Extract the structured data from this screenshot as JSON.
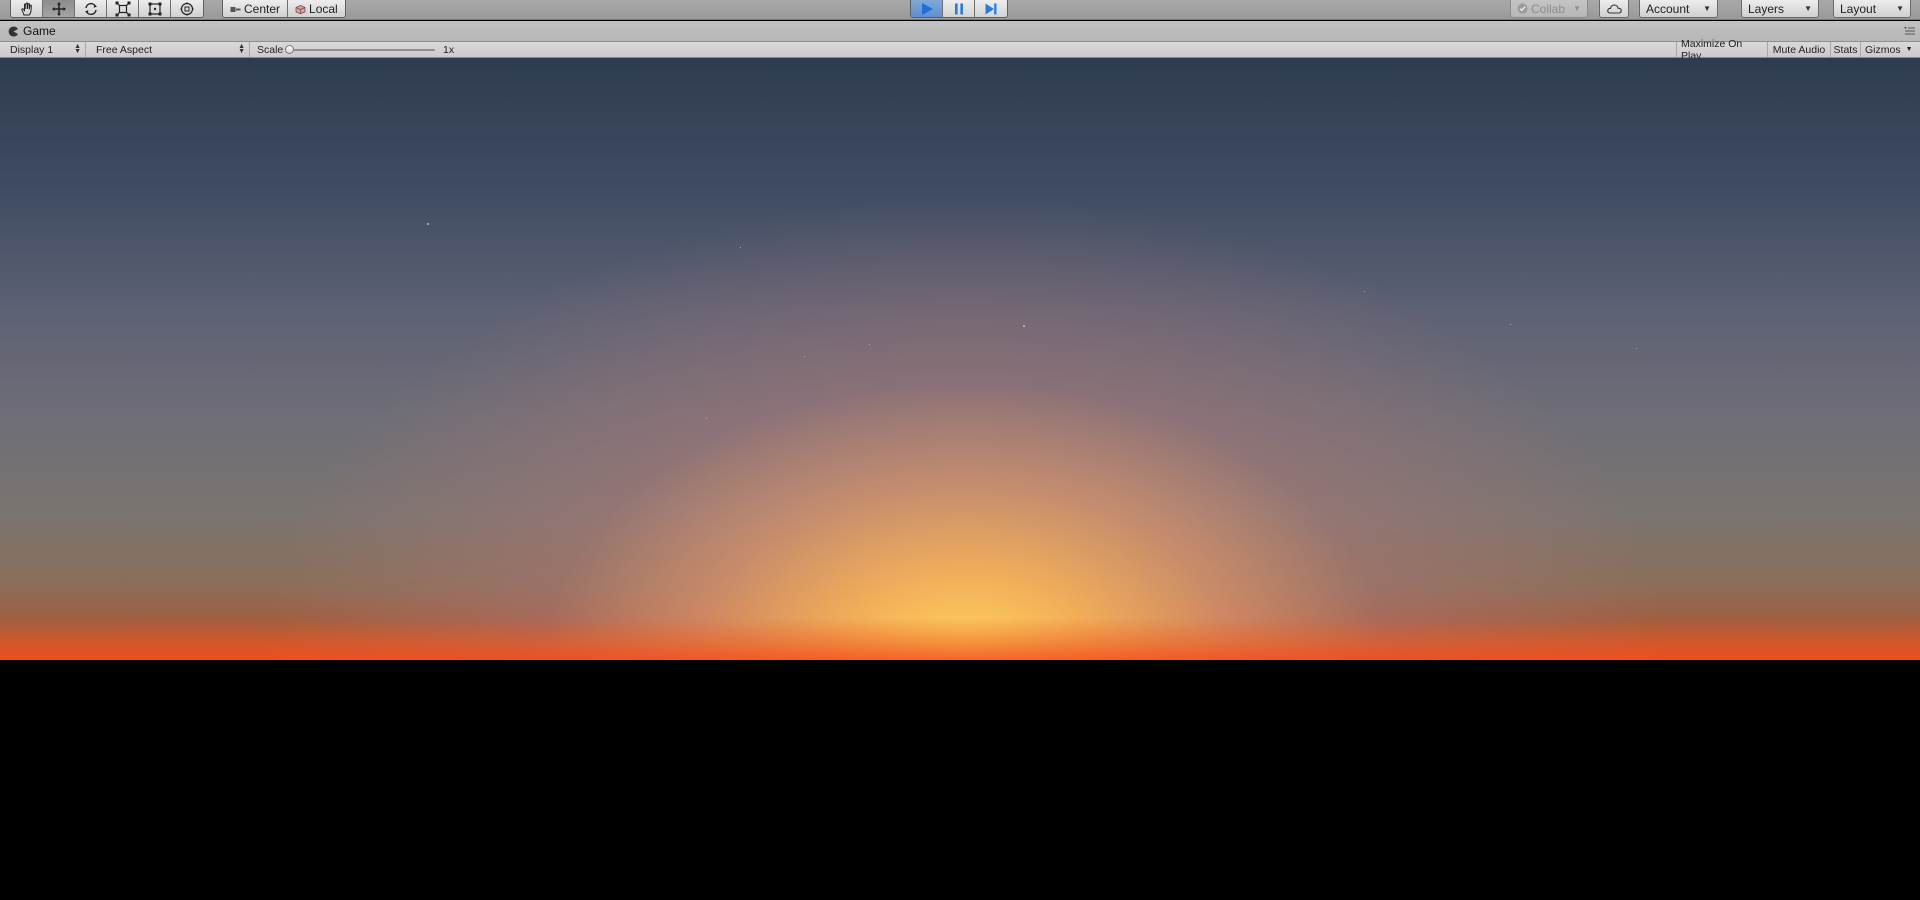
{
  "toolbar": {
    "transform_tools": [
      "hand-tool",
      "move-tool",
      "rotate-tool",
      "scale-tool",
      "rect-tool",
      "transform-tool"
    ],
    "pivot_mode_label": "Center",
    "pivot_rotation_label": "Local",
    "play_controls": [
      "play",
      "pause",
      "step"
    ],
    "collab_label": "Collab",
    "account_label": "Account",
    "layers_label": "Layers",
    "layout_label": "Layout"
  },
  "game_tab": {
    "title": "Game"
  },
  "game_controls": {
    "display_value": "Display 1",
    "aspect_value": "Free Aspect",
    "scale_label": "Scale",
    "scale_value": "1x",
    "maximize_on_play_label": "Maximize On Play",
    "mute_audio_label": "Mute Audio",
    "stats_label": "Stats",
    "gizmos_label": "Gizmos"
  },
  "colors": {
    "sky_top": "#2e3c51",
    "sun_core": "#ffd65c",
    "horizon": "#c4432a",
    "ground": "#000000",
    "play_active": "#5c8fcf"
  }
}
